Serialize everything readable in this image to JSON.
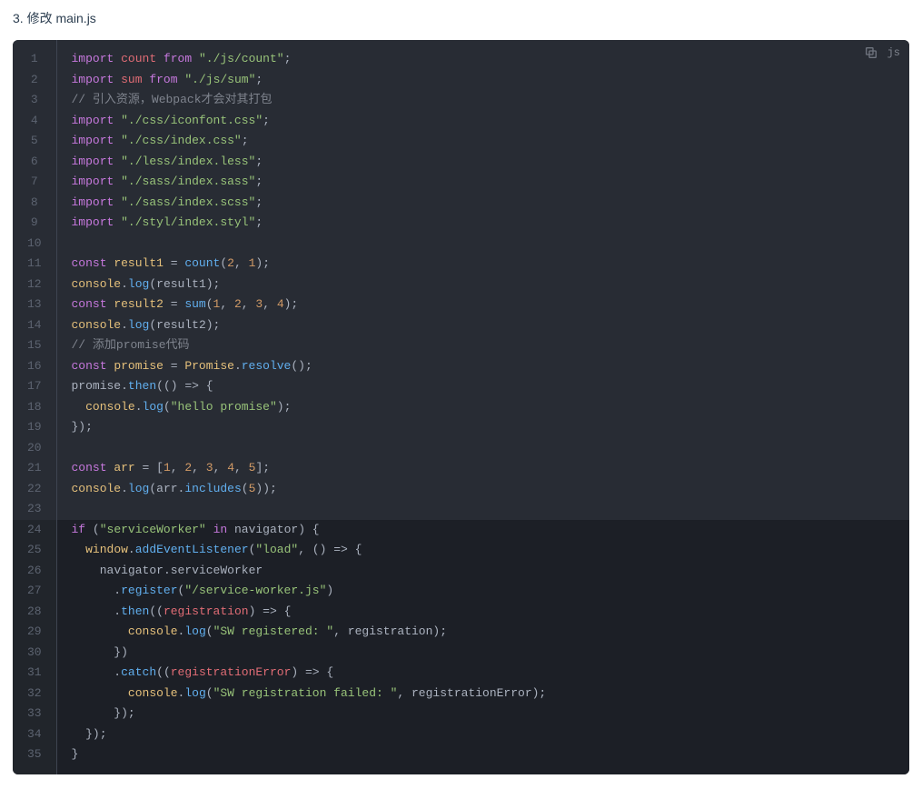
{
  "heading": "3. 修改 main.js",
  "code": {
    "language": "js",
    "highlight_start": 24,
    "highlight_end": 35,
    "tokens": [
      [
        [
          "import ",
          "kw"
        ],
        [
          "count",
          "imp"
        ],
        [
          " ",
          "pun"
        ],
        [
          "from",
          "kw"
        ],
        [
          " ",
          "pun"
        ],
        [
          "\"./js/count\"",
          "str"
        ],
        [
          ";",
          "pun"
        ]
      ],
      [
        [
          "import ",
          "kw"
        ],
        [
          "sum",
          "imp"
        ],
        [
          " ",
          "pun"
        ],
        [
          "from",
          "kw"
        ],
        [
          " ",
          "pun"
        ],
        [
          "\"./js/sum\"",
          "str"
        ],
        [
          ";",
          "pun"
        ]
      ],
      [
        [
          "// 引入资源，Webpack才会对其打包",
          "cmt"
        ]
      ],
      [
        [
          "import ",
          "kw"
        ],
        [
          "\"./css/iconfont.css\"",
          "str"
        ],
        [
          ";",
          "pun"
        ]
      ],
      [
        [
          "import ",
          "kw"
        ],
        [
          "\"./css/index.css\"",
          "str"
        ],
        [
          ";",
          "pun"
        ]
      ],
      [
        [
          "import ",
          "kw"
        ],
        [
          "\"./less/index.less\"",
          "str"
        ],
        [
          ";",
          "pun"
        ]
      ],
      [
        [
          "import ",
          "kw"
        ],
        [
          "\"./sass/index.sass\"",
          "str"
        ],
        [
          ";",
          "pun"
        ]
      ],
      [
        [
          "import ",
          "kw"
        ],
        [
          "\"./sass/index.scss\"",
          "str"
        ],
        [
          ";",
          "pun"
        ]
      ],
      [
        [
          "import ",
          "kw"
        ],
        [
          "\"./styl/index.styl\"",
          "str"
        ],
        [
          ";",
          "pun"
        ]
      ],
      [],
      [
        [
          "const ",
          "kw"
        ],
        [
          "result1",
          "def"
        ],
        [
          " = ",
          "pun"
        ],
        [
          "count",
          "fn"
        ],
        [
          "(",
          "pun"
        ],
        [
          "2",
          "num"
        ],
        [
          ", ",
          "pun"
        ],
        [
          "1",
          "num"
        ],
        [
          ");",
          "pun"
        ]
      ],
      [
        [
          "console",
          "varalt"
        ],
        [
          ".",
          "pun"
        ],
        [
          "log",
          "fn"
        ],
        [
          "(",
          "pun"
        ],
        [
          "result1",
          "pun"
        ],
        [
          ");",
          "pun"
        ]
      ],
      [
        [
          "const ",
          "kw"
        ],
        [
          "result2",
          "def"
        ],
        [
          " = ",
          "pun"
        ],
        [
          "sum",
          "fn"
        ],
        [
          "(",
          "pun"
        ],
        [
          "1",
          "num"
        ],
        [
          ", ",
          "pun"
        ],
        [
          "2",
          "num"
        ],
        [
          ", ",
          "pun"
        ],
        [
          "3",
          "num"
        ],
        [
          ", ",
          "pun"
        ],
        [
          "4",
          "num"
        ],
        [
          ");",
          "pun"
        ]
      ],
      [
        [
          "console",
          "varalt"
        ],
        [
          ".",
          "pun"
        ],
        [
          "log",
          "fn"
        ],
        [
          "(",
          "pun"
        ],
        [
          "result2",
          "pun"
        ],
        [
          ");",
          "pun"
        ]
      ],
      [
        [
          "// 添加promise代码",
          "cmt"
        ]
      ],
      [
        [
          "const ",
          "kw"
        ],
        [
          "promise",
          "def"
        ],
        [
          " = ",
          "pun"
        ],
        [
          "Promise",
          "obj"
        ],
        [
          ".",
          "pun"
        ],
        [
          "resolve",
          "fn"
        ],
        [
          "();",
          "pun"
        ]
      ],
      [
        [
          "promise",
          "pun"
        ],
        [
          ".",
          "pun"
        ],
        [
          "then",
          "fn"
        ],
        [
          "(",
          "pun"
        ],
        [
          "() => {",
          "pun"
        ]
      ],
      [
        [
          "  ",
          "pun"
        ],
        [
          "console",
          "varalt"
        ],
        [
          ".",
          "pun"
        ],
        [
          "log",
          "fn"
        ],
        [
          "(",
          "pun"
        ],
        [
          "\"hello promise\"",
          "str"
        ],
        [
          ");",
          "pun"
        ]
      ],
      [
        [
          "});",
          "pun"
        ]
      ],
      [],
      [
        [
          "const ",
          "kw"
        ],
        [
          "arr",
          "def"
        ],
        [
          " = [",
          "pun"
        ],
        [
          "1",
          "num"
        ],
        [
          ", ",
          "pun"
        ],
        [
          "2",
          "num"
        ],
        [
          ", ",
          "pun"
        ],
        [
          "3",
          "num"
        ],
        [
          ", ",
          "pun"
        ],
        [
          "4",
          "num"
        ],
        [
          ", ",
          "pun"
        ],
        [
          "5",
          "num"
        ],
        [
          "];",
          "pun"
        ]
      ],
      [
        [
          "console",
          "varalt"
        ],
        [
          ".",
          "pun"
        ],
        [
          "log",
          "fn"
        ],
        [
          "(",
          "pun"
        ],
        [
          "arr",
          "pun"
        ],
        [
          ".",
          "pun"
        ],
        [
          "includes",
          "fn"
        ],
        [
          "(",
          "pun"
        ],
        [
          "5",
          "num"
        ],
        [
          "));",
          "pun"
        ]
      ],
      [],
      [
        [
          "if ",
          "kw"
        ],
        [
          "(",
          "pun"
        ],
        [
          "\"serviceWorker\"",
          "str"
        ],
        [
          " ",
          "pun"
        ],
        [
          "in ",
          "kw"
        ],
        [
          "navigator",
          "pun"
        ],
        [
          ") {",
          "pun"
        ]
      ],
      [
        [
          "  ",
          "pun"
        ],
        [
          "window",
          "varalt"
        ],
        [
          ".",
          "pun"
        ],
        [
          "addEventListener",
          "fn"
        ],
        [
          "(",
          "pun"
        ],
        [
          "\"load\"",
          "str"
        ],
        [
          ", () => {",
          "pun"
        ]
      ],
      [
        [
          "    ",
          "pun"
        ],
        [
          "navigator",
          "pun"
        ],
        [
          ".",
          "pun"
        ],
        [
          "serviceWorker",
          "pun"
        ]
      ],
      [
        [
          "      .",
          "pun"
        ],
        [
          "register",
          "fn"
        ],
        [
          "(",
          "pun"
        ],
        [
          "\"/service-worker.js\"",
          "str"
        ],
        [
          ")",
          "pun"
        ]
      ],
      [
        [
          "      .",
          "pun"
        ],
        [
          "then",
          "fn"
        ],
        [
          "(",
          "pun"
        ],
        [
          "(",
          "pun"
        ],
        [
          "registration",
          "var"
        ],
        [
          ") => {",
          "pun"
        ]
      ],
      [
        [
          "        ",
          "pun"
        ],
        [
          "console",
          "varalt"
        ],
        [
          ".",
          "pun"
        ],
        [
          "log",
          "fn"
        ],
        [
          "(",
          "pun"
        ],
        [
          "\"SW registered: \"",
          "str"
        ],
        [
          ", registration);",
          "pun"
        ]
      ],
      [
        [
          "      })",
          "pun"
        ]
      ],
      [
        [
          "      .",
          "pun"
        ],
        [
          "catch",
          "fn"
        ],
        [
          "(",
          "pun"
        ],
        [
          "(",
          "pun"
        ],
        [
          "registrationError",
          "var"
        ],
        [
          ") => {",
          "pun"
        ]
      ],
      [
        [
          "        ",
          "pun"
        ],
        [
          "console",
          "varalt"
        ],
        [
          ".",
          "pun"
        ],
        [
          "log",
          "fn"
        ],
        [
          "(",
          "pun"
        ],
        [
          "\"SW registration failed: \"",
          "str"
        ],
        [
          ", registrationError);",
          "pun"
        ]
      ],
      [
        [
          "      });",
          "pun"
        ]
      ],
      [
        [
          "  });",
          "pun"
        ]
      ],
      [
        [
          "}",
          "pun"
        ]
      ]
    ]
  },
  "icons": {
    "copy": "copy-icon"
  }
}
